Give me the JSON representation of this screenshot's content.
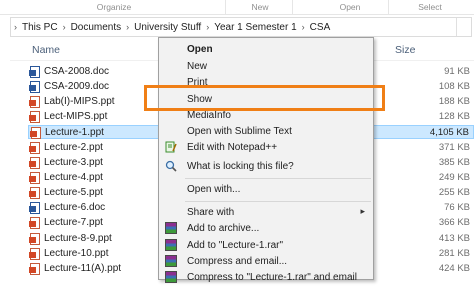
{
  "ribbon": {
    "sections": [
      "Organize",
      "New",
      "Open",
      "Select"
    ]
  },
  "address": {
    "crumbs": [
      "This PC",
      "Documents",
      "University Stuff",
      "Year 1 Semester 1",
      "CSA"
    ],
    "separator": "›"
  },
  "columns": {
    "name": "Name",
    "size": "Size"
  },
  "files": [
    {
      "name": "CSA-2008.doc",
      "size": "91 KB",
      "type": "doc"
    },
    {
      "name": "CSA-2009.doc",
      "size": "108 KB",
      "type": "doc"
    },
    {
      "name": "Lab(I)-MIPS.ppt",
      "size": "188 KB",
      "type": "ppt"
    },
    {
      "name": "Lect-MIPS.ppt",
      "size": "128 KB",
      "type": "ppt"
    },
    {
      "name": "Lecture-1.ppt",
      "size": "4,105 KB",
      "type": "ppt",
      "selected": true
    },
    {
      "name": "Lecture-2.ppt",
      "size": "371 KB",
      "type": "ppt"
    },
    {
      "name": "Lecture-3.ppt",
      "size": "385 KB",
      "type": "ppt"
    },
    {
      "name": "Lecture-4.ppt",
      "size": "249 KB",
      "type": "ppt"
    },
    {
      "name": "Lecture-5.ppt",
      "size": "255 KB",
      "type": "ppt"
    },
    {
      "name": "Lecture-6.doc",
      "size": "76 KB",
      "type": "doc"
    },
    {
      "name": "Lecture-7.ppt",
      "size": "366 KB",
      "type": "ppt"
    },
    {
      "name": "Lecture-8-9.ppt",
      "size": "413 KB",
      "type": "ppt"
    },
    {
      "name": "Lecture-10.ppt",
      "size": "281 KB",
      "type": "ppt"
    },
    {
      "name": "Lecture-11(A).ppt",
      "size": "424 KB",
      "type": "ppt"
    }
  ],
  "menu": {
    "items": [
      {
        "label": "Open",
        "bold": true
      },
      {
        "label": "New"
      },
      {
        "label": "Print"
      },
      {
        "label": "Show"
      },
      {
        "label": "MediaInfo"
      },
      {
        "label": "Open with Sublime Text"
      },
      {
        "label": "Edit with Notepad++",
        "icon": "notepad-icon"
      },
      {
        "label": "What is locking this file?",
        "icon": "magnifier-icon"
      },
      {
        "label": "Open with..."
      },
      {
        "label": "Share with",
        "submenu": true
      },
      {
        "label": "Add to archive...",
        "icon": "winrar-icon"
      },
      {
        "label": "Add to \"Lecture-1.rar\"",
        "icon": "winrar-icon"
      },
      {
        "label": "Compress and email...",
        "icon": "winrar-icon"
      },
      {
        "label": "Compress to \"Lecture-1.rar\" and email",
        "icon": "winrar-icon"
      }
    ]
  },
  "highlight": {
    "color": "#f07f16",
    "target": "Show"
  },
  "colors": {
    "selection": "#cce8ff",
    "selection_border": "#99d1ff",
    "ppt": "#d24726",
    "doc": "#2b579a"
  }
}
